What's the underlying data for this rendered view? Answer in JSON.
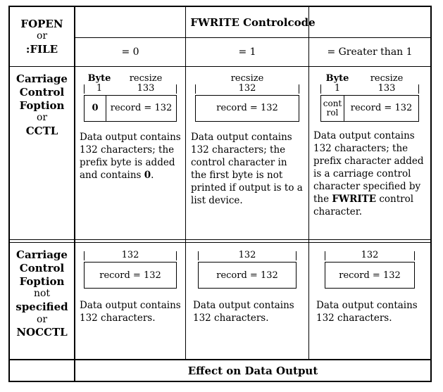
{
  "header": {
    "corner_label": {
      "line1": "FOPEN",
      "line2": "or",
      "line3": ":FILE"
    },
    "controlcode_title": "FWRITE Controlcode",
    "subcolumns": [
      "= 0",
      "= 1",
      "= Greater than 1"
    ]
  },
  "footer": {
    "label": "Effect on Data Output"
  },
  "rows": [
    {
      "label": {
        "l1": "Carriage",
        "l2": "Control",
        "l3": "Foption",
        "l4": "or",
        "l5": "CCTL"
      },
      "cells": [
        {
          "dim_left": "Byte",
          "dim_right": "recsize",
          "val_left": "1",
          "val_right": "133",
          "prefix": "0",
          "record": "record = 132",
          "text_before": "Data output contains 132 characters; the prefix byte is added and contains ",
          "text_bold": "0",
          "text_after": "."
        },
        {
          "dim_left": "",
          "dim_right": "recsize",
          "val_left": "",
          "val_right": "132",
          "prefix": "",
          "record": "record = 132",
          "text_before": "Data output contains 132 characters; the control character in the first byte is not printed if output is to a list device.",
          "text_bold": "",
          "text_after": ""
        },
        {
          "dim_left": "Byte",
          "dim_right": "recsize",
          "val_left": "1",
          "val_right": "133",
          "prefix": "control",
          "record": "record = 132",
          "text_before": "Data output contains 132 characters; the prefix character added is a carriage control character specified by the ",
          "text_bold": "FWRITE",
          "text_after": " control character."
        }
      ]
    },
    {
      "label": {
        "l1": "Carriage",
        "l2": "Control",
        "l3": "Foption",
        "l4": "not",
        "l5": "specified",
        "l6": "or",
        "l7": "NOCCTL"
      },
      "cells": [
        {
          "dim_left": "",
          "dim_right": "",
          "val_left": "",
          "val_right": "132",
          "prefix": "",
          "record": "record = 132",
          "text_before": "Data output contains 132 characters.",
          "text_bold": "",
          "text_after": ""
        },
        {
          "dim_left": "",
          "dim_right": "",
          "val_left": "",
          "val_right": "132",
          "prefix": "",
          "record": "record = 132",
          "text_before": "Data output contains 132 characters.",
          "text_bold": "",
          "text_after": ""
        },
        {
          "dim_left": "",
          "dim_right": "",
          "val_left": "",
          "val_right": "132",
          "prefix": "",
          "record": "record = 132",
          "text_before": "Data output contains 132 characters.",
          "text_bold": "",
          "text_after": ""
        }
      ]
    }
  ]
}
